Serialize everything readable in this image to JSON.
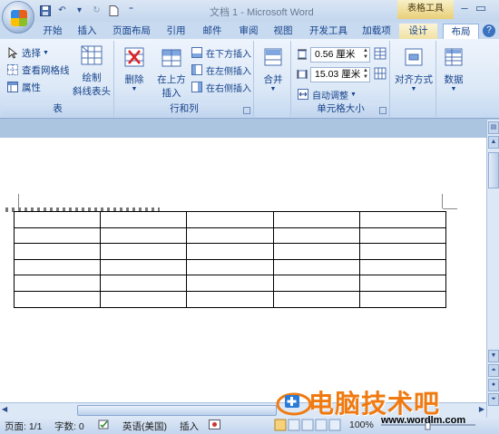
{
  "titlebar": {
    "title": "文档 1 - Microsoft Word",
    "context_header": "表格工具"
  },
  "tabs": [
    {
      "label": "开始"
    },
    {
      "label": "插入"
    },
    {
      "label": "页面布局"
    },
    {
      "label": "引用"
    },
    {
      "label": "邮件"
    },
    {
      "label": "审阅"
    },
    {
      "label": "视图"
    },
    {
      "label": "开发工具"
    },
    {
      "label": "加载项"
    },
    {
      "label": "设计"
    },
    {
      "label": "布局"
    }
  ],
  "ribbon": {
    "table_group": {
      "label": "表",
      "select": "选择",
      "view_gridlines": "查看网格线",
      "properties": "属性",
      "draw_diagonal_1": "绘制",
      "draw_diagonal_2": "斜线表头"
    },
    "rows_cols_group": {
      "label": "行和列",
      "delete": "删除",
      "insert_above_1": "在上方",
      "insert_above_2": "插入",
      "insert_below": "在下方插入",
      "insert_left": "在左侧插入",
      "insert_right": "在右侧插入"
    },
    "merge_group": {
      "merge": "合并"
    },
    "cell_size_group": {
      "label": "单元格大小",
      "height": "0.56 厘米",
      "width": "15.03 厘米",
      "autofit": "自动调整"
    },
    "alignment": "对齐方式",
    "data": "数据"
  },
  "document": {
    "table_rows": 6,
    "table_cols": 5
  },
  "statusbar": {
    "page": "页面: 1/1",
    "words": "字数: 0",
    "language": "英语(美国)",
    "mode": "插入",
    "zoom": "100%"
  },
  "watermark": {
    "brand": "电脑技术吧",
    "url": "www.wordlm.com"
  }
}
